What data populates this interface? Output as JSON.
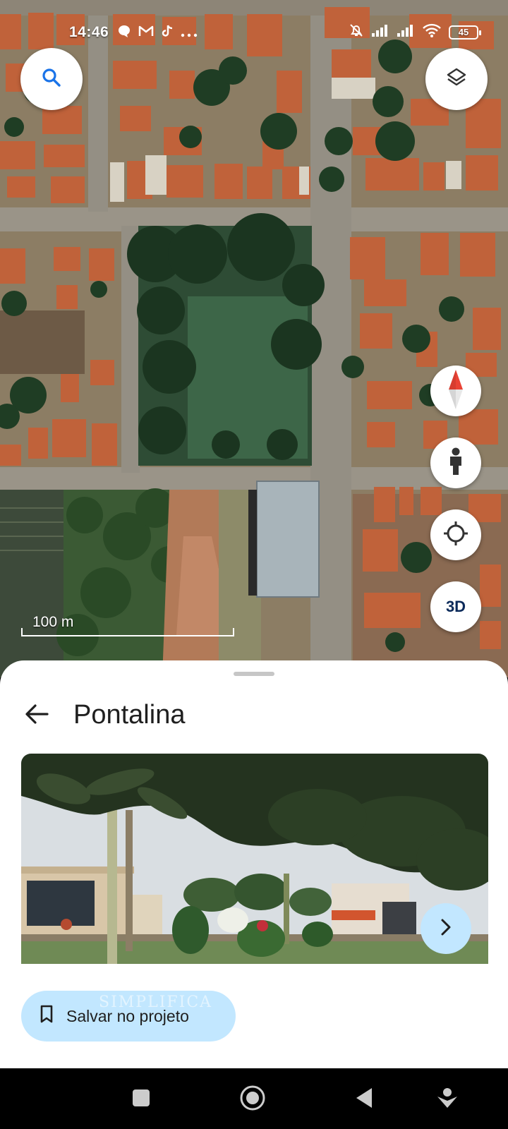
{
  "status_bar": {
    "time": "14:46",
    "left_icons": [
      "chat-bubble-icon",
      "gmail-icon",
      "tiktok-icon",
      "more-dots-icon"
    ],
    "right_icons": [
      "bell-off-icon",
      "signal-icon",
      "signal-icon",
      "wifi-icon"
    ],
    "battery": "45"
  },
  "map": {
    "search_icon": "search-icon",
    "layers_icon": "layers-icon",
    "controls": [
      "compass-icon",
      "street-view-icon",
      "my-location-icon"
    ],
    "three_d_label": "3D",
    "scale_label": "100 m"
  },
  "place_sheet": {
    "title": "Pontalina",
    "photo_next_icon": "chevron-right-icon",
    "save_button_label": "Salvar no projeto",
    "save_icon": "bookmark-icon",
    "watermark": "SIMPLIFICA"
  },
  "nav_bar": {
    "buttons": [
      "recents-icon",
      "home-icon",
      "back-icon",
      "assistant-icon"
    ]
  },
  "colors": {
    "accent_light_blue": "#c2e7ff",
    "icon_blue": "#1a73e8",
    "compass_red": "#ea4335"
  }
}
